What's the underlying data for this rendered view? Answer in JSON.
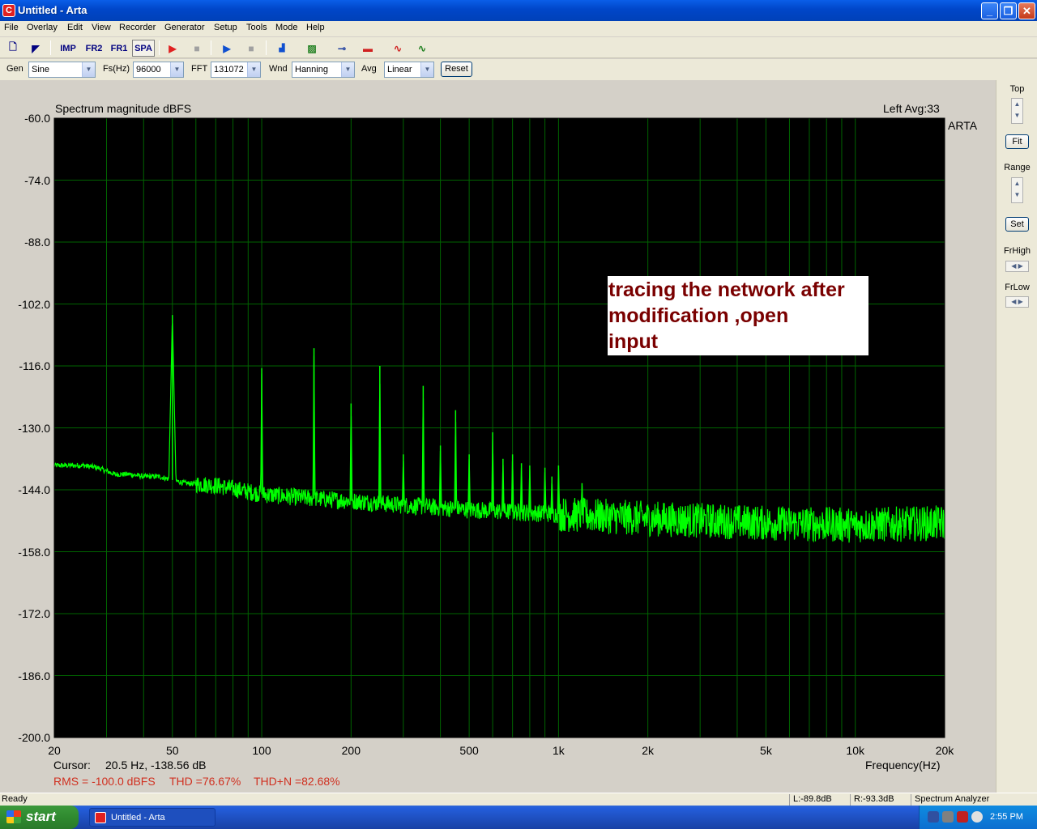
{
  "window": {
    "title": "Untitled - Arta",
    "app_icon_letter": "C"
  },
  "menu": [
    "File",
    "Overlay",
    "Edit",
    "View",
    "Recorder",
    "Generator",
    "Setup",
    "Tools",
    "Mode",
    "Help"
  ],
  "toolbar": {
    "imp": "IMP",
    "fr2": "FR2",
    "fr1": "FR1",
    "spa": "SPA"
  },
  "options": {
    "gen_label": "Gen",
    "gen_value": "Sine",
    "fs_label": "Fs(Hz)",
    "fs_value": "96000",
    "fft_label": "FFT",
    "fft_value": "131072",
    "wnd_label": "Wnd",
    "wnd_value": "Hanning",
    "avg_label": "Avg",
    "avg_value": "Linear",
    "reset_label": "Reset"
  },
  "chart_data": {
    "type": "line",
    "title": "Spectrum magnitude dBFS",
    "info": "Left  Avg:33",
    "watermark": "ARTA",
    "xlabel": "Frequency(Hz)",
    "xscale": "log",
    "xlim": [
      20,
      20000
    ],
    "ylim": [
      -200,
      -60
    ],
    "yticks": [
      "-60.0",
      "-74.0",
      "-88.0",
      "-102.0",
      "-116.0",
      "-130.0",
      "-144.0",
      "-158.0",
      "-172.0",
      "-186.0",
      "-200.0"
    ],
    "xticks": [
      {
        "v": 20,
        "t": "20"
      },
      {
        "v": 50,
        "t": "50"
      },
      {
        "v": 100,
        "t": "100"
      },
      {
        "v": 200,
        "t": "200"
      },
      {
        "v": 500,
        "t": "500"
      },
      {
        "v": 1000,
        "t": "1k"
      },
      {
        "v": 2000,
        "t": "2k"
      },
      {
        "v": 5000,
        "t": "5k"
      },
      {
        "v": 10000,
        "t": "10k"
      },
      {
        "v": 20000,
        "t": "20k"
      }
    ],
    "grid": true,
    "series": [
      {
        "color": "#00ff00",
        "floor": [
          [
            20,
            -138.5
          ],
          [
            25,
            -138.5
          ],
          [
            28,
            -139
          ],
          [
            32,
            -140.5
          ],
          [
            36,
            -140.5
          ],
          [
            40,
            -141
          ],
          [
            45,
            -141
          ],
          [
            55,
            -142.5
          ],
          [
            70,
            -143
          ],
          [
            100,
            -145
          ],
          [
            150,
            -146
          ],
          [
            200,
            -146.5
          ],
          [
            300,
            -147.5
          ],
          [
            500,
            -148.5
          ],
          [
            1000,
            -149.5
          ],
          [
            2000,
            -150.5
          ],
          [
            5000,
            -151.5
          ],
          [
            10000,
            -152
          ],
          [
            20000,
            -151.5
          ]
        ],
        "peaks": [
          [
            50,
            -104.5
          ],
          [
            100,
            -116.5
          ],
          [
            150,
            -112
          ],
          [
            200,
            -124.5
          ],
          [
            250,
            -116
          ],
          [
            300,
            -136
          ],
          [
            350,
            -120.5
          ],
          [
            400,
            -134
          ],
          [
            450,
            -126
          ],
          [
            500,
            -136
          ],
          [
            600,
            -131
          ],
          [
            650,
            -137
          ],
          [
            700,
            -136
          ],
          [
            750,
            -138
          ],
          [
            800,
            -138.5
          ],
          [
            900,
            -139
          ],
          [
            950,
            -141
          ],
          [
            1000,
            -138.5
          ],
          [
            1200,
            -142.5
          ]
        ]
      }
    ],
    "cursor_label": "Cursor:",
    "cursor_value": "20.5 Hz, -138.56 dB",
    "rms": "RMS = -100.0 dBFS",
    "thd": "THD =76.67%",
    "thdn": "THD+N =82.68%"
  },
  "annotation": {
    "line1": "tracing the network after",
    "line2": "modification ,open",
    "line3": "input"
  },
  "right_panel": {
    "top": "Top",
    "fit": "Fit",
    "range": "Range",
    "set": "Set",
    "frhigh": "FrHigh",
    "frlow": "FrLow"
  },
  "status": {
    "ready": "Ready",
    "left": "L:-89.8dB",
    "right": "R:-93.3dB",
    "mode": "Spectrum Analyzer"
  },
  "taskbar": {
    "start": "start",
    "task": "Untitled - Arta",
    "clock": "2:55 PM"
  }
}
